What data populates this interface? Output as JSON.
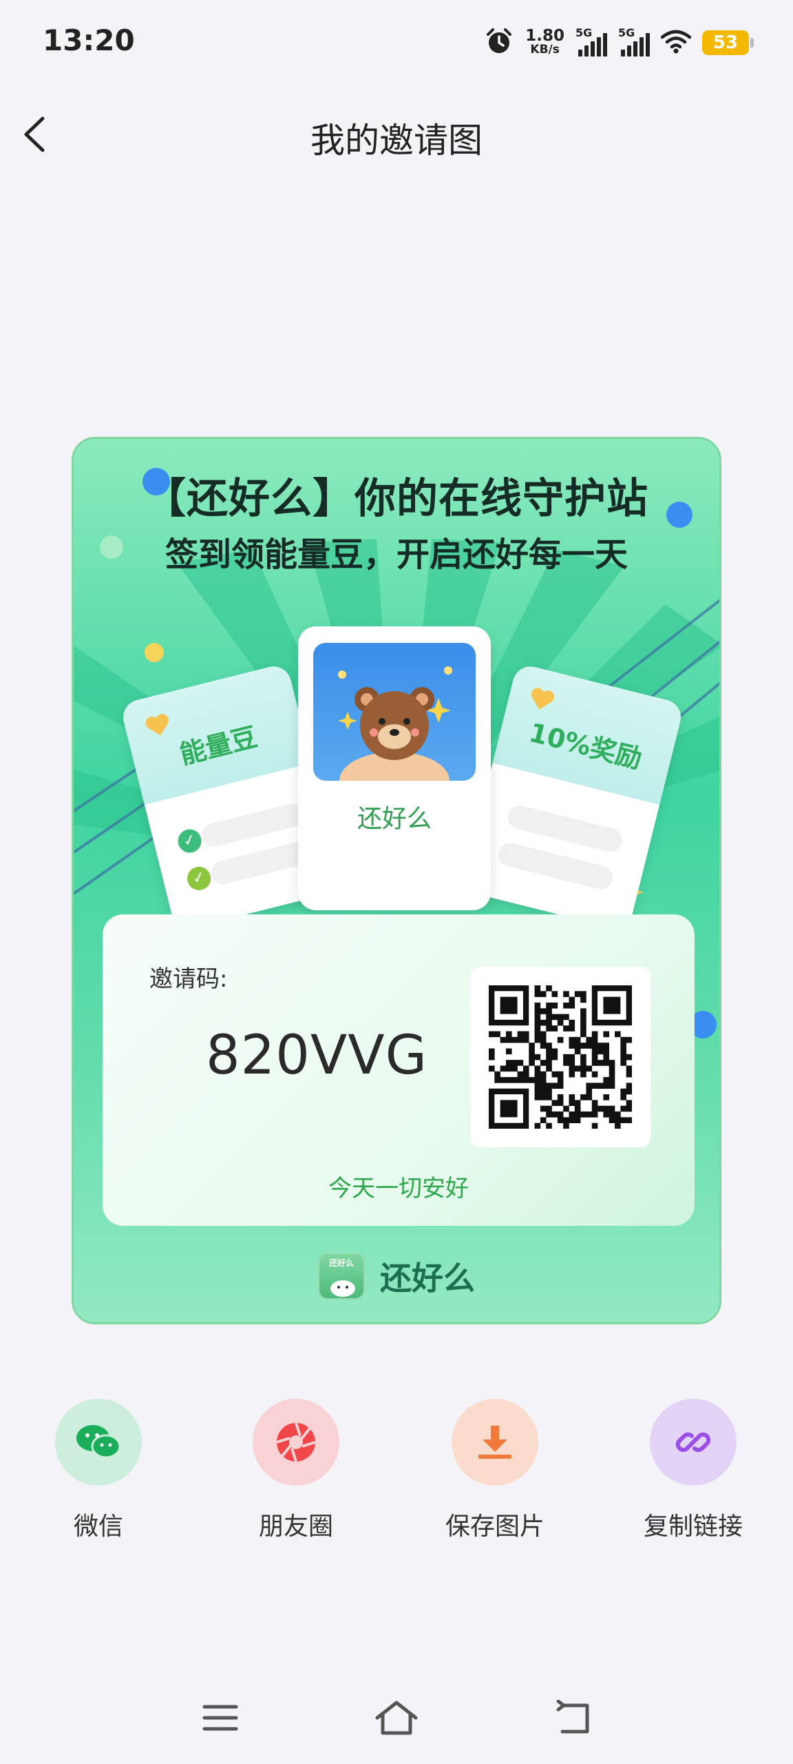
{
  "status_bar": {
    "time": "13:20",
    "speed_value": "1.80",
    "speed_unit": "KB/s",
    "sim1_label": "5G",
    "sim2_label": "5G",
    "battery": "53",
    "icons": [
      "alarm-icon",
      "signal-icon",
      "signal-icon",
      "wifi-icon",
      "battery-icon"
    ]
  },
  "header": {
    "title": "我的邀请图",
    "back_icon": "chevron-left-icon"
  },
  "poster": {
    "headline": "【还好么】你的在线守护站",
    "subheadline": "签到领能量豆，开启还好每一天",
    "card_left_label": "能量豆",
    "card_center_label": "还好么",
    "card_right_label": "10%奖励",
    "invite_label": "邀请码:",
    "invite_code": "820VVG",
    "tagline": "今天一切安好",
    "brand_logo_text": "还好么",
    "brand_name": "还好么",
    "colors": {
      "accent_green": "#2fa84d",
      "poster_green": "#3fd4a0"
    }
  },
  "share": {
    "items": [
      {
        "label": "微信",
        "icon": "wechat-icon",
        "color": "#1aad5a"
      },
      {
        "label": "朋友圈",
        "icon": "moments-icon",
        "color": "#f04848"
      },
      {
        "label": "保存图片",
        "icon": "download-icon",
        "color": "#f07a3c"
      },
      {
        "label": "复制链接",
        "icon": "link-icon",
        "color": "#9a50e6"
      }
    ]
  },
  "nav_bar": {
    "icons": [
      "menu-icon",
      "home-icon",
      "back-icon"
    ]
  }
}
